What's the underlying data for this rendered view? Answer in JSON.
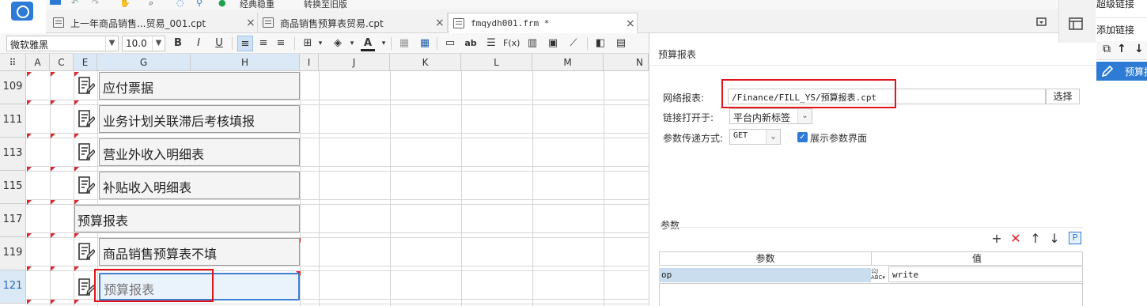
{
  "top_menu": {
    "item_1": "经典稳重",
    "item_2": "转换至旧版"
  },
  "tabs": [
    {
      "label": "上一年商品销售...贸易_001.cpt",
      "close": "×"
    },
    {
      "label": "商品销售预算表贸易.cpt",
      "close": "×"
    },
    {
      "label": "fmqydh001.frm *",
      "close": "×"
    }
  ],
  "toolbar": {
    "font_name": "微软雅黑",
    "font_size": "10.0",
    "bold": "B",
    "italic": "I",
    "underline": "U",
    "fx": "F(x)"
  },
  "sheet": {
    "columns": [
      "A",
      "C",
      "E",
      "G",
      "H",
      "I",
      "J",
      "K",
      "L",
      "M",
      "N"
    ],
    "rows": [
      {
        "number": "109",
        "label": "应付票据"
      },
      {
        "number": "111",
        "label": "业务计划关联滞后考核填报"
      },
      {
        "number": "113",
        "label": "营业外收入明细表"
      },
      {
        "number": "115",
        "label": "补贴收入明细表"
      },
      {
        "number": "117",
        "label": "预算报表"
      },
      {
        "number": "119",
        "label": "商品销售预算表不填"
      },
      {
        "number": "121",
        "label": "预算报表"
      }
    ]
  },
  "panel": {
    "title": "预算报表",
    "url_label": "网络报表:",
    "url_value": "/Finance/FILL_YS/预算报表.cpt",
    "select_button": "选择",
    "open_in_label": "链接打开于:",
    "open_in_value": "平台内新标签",
    "method_label": "参数传递方式:",
    "method_value": "GET",
    "show_params_label": "展示参数界面",
    "params_label": "参数",
    "param_columns": [
      "参数",
      "值"
    ],
    "params": [
      {
        "name": "op",
        "type_icon": "公式/ABC",
        "value": "write"
      }
    ]
  },
  "right_gutter": {
    "title_1": "超级链接",
    "title_2": "添加链接",
    "selected_item": "预算报"
  },
  "colors": {
    "accent": "#2e7bd6",
    "highlight_red": "#e1141c",
    "selected_cell": "#eaf2fb"
  }
}
